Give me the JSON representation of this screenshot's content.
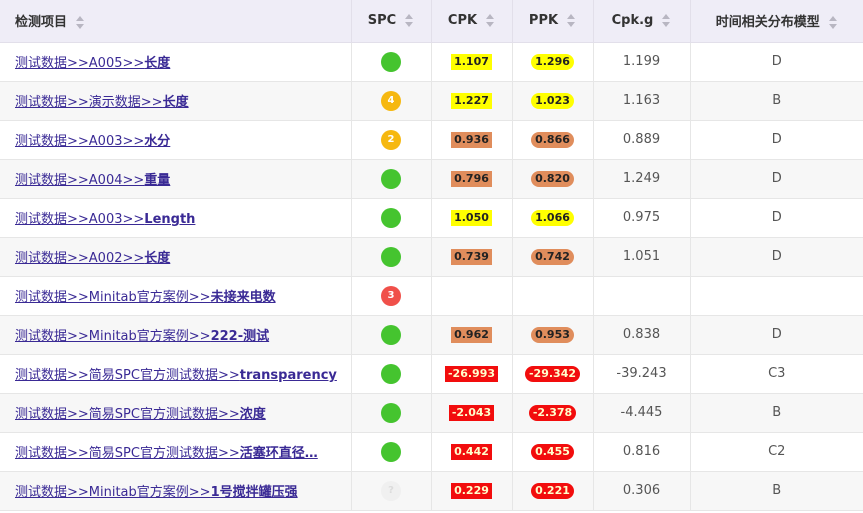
{
  "columns": {
    "item": "检测项目",
    "spc": "SPC",
    "cpk": "CPK",
    "ppk": "PPK",
    "cpkg": "Cpk.g",
    "model": "时间相关分布模型"
  },
  "rows": [
    {
      "prefix": "测试数据>>A005>>",
      "name": "长度",
      "spc": {
        "status": "green",
        "badge": ""
      },
      "cpk": "1.107",
      "cpk_color": "yellow",
      "ppk": "1.296",
      "ppk_color": "yellow",
      "cpkg": "1.199",
      "model": "D"
    },
    {
      "prefix": "测试数据>>演示数据>>",
      "name": "长度",
      "spc": {
        "status": "orange",
        "badge": "4"
      },
      "cpk": "1.227",
      "cpk_color": "yellow",
      "ppk": "1.023",
      "ppk_color": "yellow",
      "cpkg": "1.163",
      "model": "B"
    },
    {
      "prefix": "测试数据>>A003>>",
      "name": "水分",
      "spc": {
        "status": "orange",
        "badge": "2"
      },
      "cpk": "0.936",
      "cpk_color": "brown",
      "ppk": "0.866",
      "ppk_color": "brown",
      "cpkg": "0.889",
      "model": "D"
    },
    {
      "prefix": "测试数据>>A004>>",
      "name": "重量",
      "spc": {
        "status": "green",
        "badge": ""
      },
      "cpk": "0.796",
      "cpk_color": "brown",
      "ppk": "0.820",
      "ppk_color": "brown",
      "cpkg": "1.249",
      "model": "D"
    },
    {
      "prefix": "测试数据>>A003>>",
      "name": "Length",
      "spc": {
        "status": "green",
        "badge": ""
      },
      "cpk": "1.050",
      "cpk_color": "yellow",
      "ppk": "1.066",
      "ppk_color": "yellow",
      "cpkg": "0.975",
      "model": "D"
    },
    {
      "prefix": "测试数据>>A002>>",
      "name": "长度",
      "spc": {
        "status": "green",
        "badge": ""
      },
      "cpk": "0.739",
      "cpk_color": "brown",
      "ppk": "0.742",
      "ppk_color": "brown",
      "cpkg": "1.051",
      "model": "D"
    },
    {
      "prefix": "测试数据>>Minitab官方案例>>",
      "name": "未接来电数",
      "spc": {
        "status": "red",
        "badge": "3"
      },
      "cpk": "",
      "cpk_color": "",
      "ppk": "",
      "ppk_color": "",
      "cpkg": "",
      "model": ""
    },
    {
      "prefix": "测试数据>>Minitab官方案例>>",
      "name": "222-测试",
      "spc": {
        "status": "green",
        "badge": ""
      },
      "cpk": "0.962",
      "cpk_color": "brown",
      "ppk": "0.953",
      "ppk_color": "brown",
      "cpkg": "0.838",
      "model": "D"
    },
    {
      "prefix": "测试数据>>简易SPC官方测试数据>>",
      "name": "transparency",
      "spc": {
        "status": "green",
        "badge": ""
      },
      "cpk": "-26.993",
      "cpk_color": "red",
      "ppk": "-29.342",
      "ppk_color": "red",
      "cpkg": "-39.243",
      "model": "C3"
    },
    {
      "prefix": "测试数据>>简易SPC官方测试数据>>",
      "name": "浓度",
      "spc": {
        "status": "green",
        "badge": ""
      },
      "cpk": "-2.043",
      "cpk_color": "red",
      "ppk": "-2.378",
      "ppk_color": "red",
      "cpkg": "-4.445",
      "model": "B"
    },
    {
      "prefix": "测试数据>>简易SPC官方测试数据>>",
      "name": "活塞环直径…",
      "spc": {
        "status": "green",
        "badge": ""
      },
      "cpk": "0.442",
      "cpk_color": "red",
      "ppk": "0.455",
      "ppk_color": "red",
      "cpkg": "0.816",
      "model": "C2"
    },
    {
      "prefix": "测试数据>>Minitab官方案例>>",
      "name": "1号搅拌罐压强",
      "spc": {
        "status": "grey",
        "badge": "?"
      },
      "cpk": "0.229",
      "cpk_color": "red",
      "ppk": "0.221",
      "ppk_color": "red",
      "cpkg": "0.306",
      "model": "B"
    }
  ],
  "colors": {
    "header_bg": "#efedf7",
    "link": "#3a2a95",
    "green": "#45c42f",
    "orange": "#f6b810",
    "red": "#f0504a",
    "val_yellow": "#ffff00",
    "val_brown": "#e08d5c",
    "val_red": "#f20d0d"
  },
  "icons": {
    "sort": "sort-arrows-icon",
    "spc": "status-dot-icon"
  }
}
